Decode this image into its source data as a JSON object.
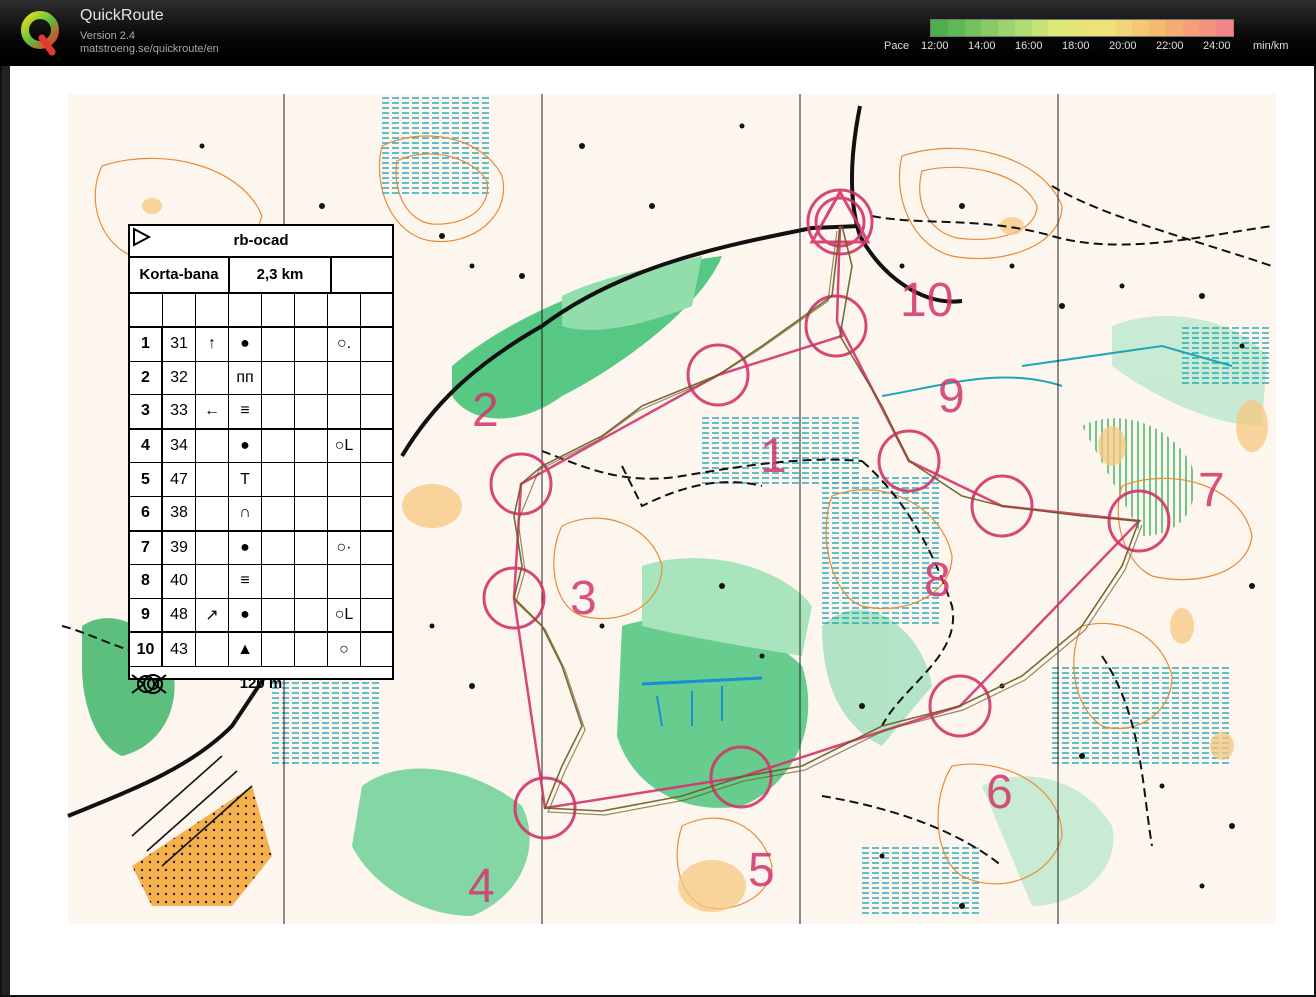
{
  "app": {
    "title": "QuickRoute",
    "version": "Version 2.4",
    "url": "matstroeng.se/quickroute/en"
  },
  "pace_scale": {
    "label": "Pace",
    "ticks": [
      "12:00",
      "14:00",
      "16:00",
      "18:00",
      "20:00",
      "22:00",
      "24:00"
    ],
    "unit": "min/km",
    "colors": [
      "#4cae4c",
      "#8fcf6a",
      "#d8e878",
      "#f2e07a",
      "#f4b26e",
      "#f28585"
    ]
  },
  "control_description": {
    "title": "rb-ocad",
    "course_name": "Korta-bana",
    "course_length": "2,3 km",
    "rows": [
      {
        "num": "1",
        "code": "31",
        "dir": "↑",
        "feature": "●",
        "detail": "○."
      },
      {
        "num": "2",
        "code": "32",
        "dir": "",
        "feature": "ᴨᴨ",
        "detail": ""
      },
      {
        "num": "3",
        "code": "33",
        "dir": "←",
        "feature": "≡",
        "detail": ""
      },
      {
        "num": "4",
        "code": "34",
        "dir": "",
        "feature": "●",
        "detail": "○L"
      },
      {
        "num": "5",
        "code": "47",
        "dir": "",
        "feature": "T",
        "detail": ""
      },
      {
        "num": "6",
        "code": "38",
        "dir": "",
        "feature": "∩",
        "detail": ""
      },
      {
        "num": "7",
        "code": "39",
        "dir": "",
        "feature": "●",
        "detail": "○·"
      },
      {
        "num": "8",
        "code": "40",
        "dir": "",
        "feature": "≡",
        "detail": ""
      },
      {
        "num": "9",
        "code": "48",
        "dir": "↗",
        "feature": "●",
        "detail": "○L"
      },
      {
        "num": "10",
        "code": "43",
        "dir": "",
        "feature": "▲",
        "detail": "○"
      }
    ],
    "footer": "120 m"
  },
  "map": {
    "control_numbers": [
      "1",
      "2",
      "3",
      "4",
      "5",
      "6",
      "7",
      "8",
      "9",
      "10"
    ],
    "course_color": "#d2356b",
    "route_color": "#7a6a2a"
  }
}
